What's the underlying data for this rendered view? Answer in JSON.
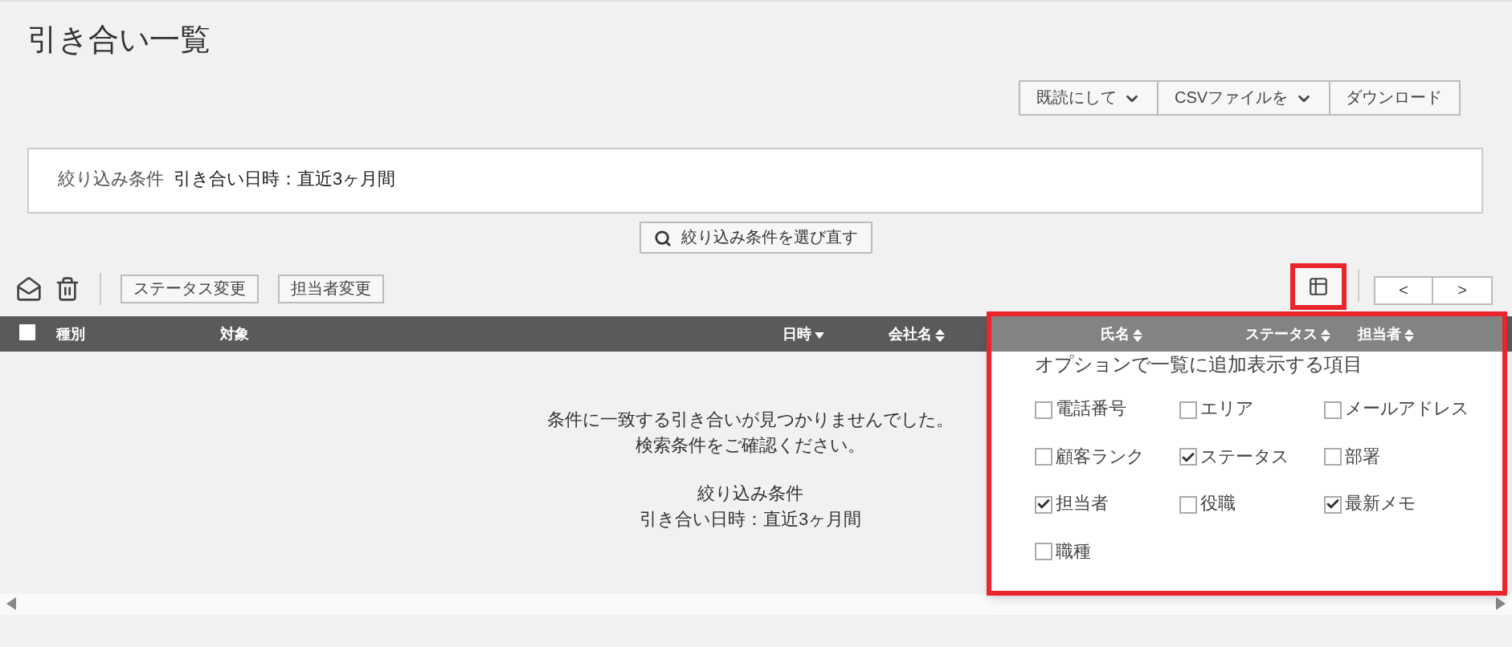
{
  "title": "引き合い一覧",
  "action_buttons": [
    {
      "label": "既読にして",
      "dropdown": true
    },
    {
      "label": "CSVファイルを",
      "dropdown": true
    },
    {
      "label": "ダウンロード",
      "dropdown": false
    }
  ],
  "filter": {
    "label": "絞り込み条件",
    "value": "引き合い日時：直近3ヶ月間"
  },
  "reselect_button": "絞り込み条件を選び直す",
  "toolbar": {
    "buttons": [
      "ステータス変更",
      "担当者変更"
    ],
    "prev": "<",
    "next": ">"
  },
  "table": {
    "select_all": false,
    "columns": [
      {
        "label": "種別",
        "sortable": false
      },
      {
        "label": "対象",
        "sortable": false
      },
      {
        "label": "日時",
        "sortable": true,
        "sorted": true
      },
      {
        "label": "会社名",
        "sortable": true,
        "sorted": false
      },
      {
        "label": "氏名",
        "sortable": true,
        "sorted": false
      },
      {
        "label": "ステータス",
        "sortable": true,
        "sorted": false
      },
      {
        "label": "担当者",
        "sortable": true,
        "sorted": false
      }
    ],
    "empty_message": [
      "条件に一致する引き合いが見つかりませんでした。",
      "検索条件をご確認ください。"
    ],
    "empty_filter": [
      "絞り込み条件",
      "引き合い日時：直近3ヶ月間"
    ]
  },
  "column_options": {
    "title": "オプションで一覧に追加表示する項目",
    "items": [
      {
        "label": "電話番号",
        "checked": false
      },
      {
        "label": "エリア",
        "checked": false
      },
      {
        "label": "メールアドレス",
        "checked": false
      },
      {
        "label": "顧客ランク",
        "checked": false
      },
      {
        "label": "ステータス",
        "checked": true
      },
      {
        "label": "部署",
        "checked": false
      },
      {
        "label": "担当者",
        "checked": true
      },
      {
        "label": "役職",
        "checked": false
      },
      {
        "label": "最新メモ",
        "checked": true
      },
      {
        "label": "職種",
        "checked": false
      }
    ]
  }
}
